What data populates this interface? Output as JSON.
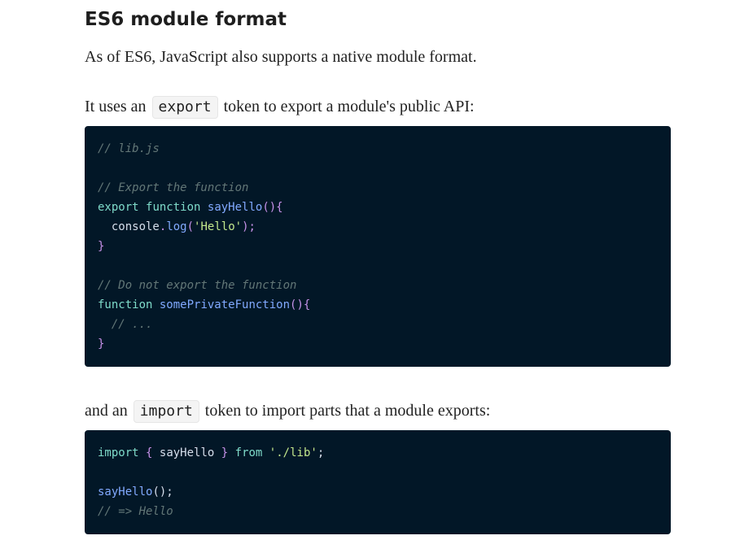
{
  "article": {
    "heading": "ES6 module format",
    "intro": "As of ES6, JavaScript also supports a native module format.",
    "export_text_before": "It uses an",
    "export_token": "export",
    "export_text_after": "token to export a module's public API:",
    "import_text_before": "and an",
    "import_token": "import",
    "import_text_after": "token to import parts that a module exports:"
  },
  "code_export": {
    "l1": "// lib.js",
    "l3": "// Export the function",
    "l4_kw1": "export",
    "l4_kw2": "function",
    "l4_fn": "sayHello",
    "l4_p": "(){",
    "l5_obj": "console",
    "l5_dot": ".",
    "l5_fn": "log",
    "l5_p1": "(",
    "l5_str": "'Hello'",
    "l5_p2": ");",
    "l6": "}",
    "l8": "// Do not export the function",
    "l9_kw": "function",
    "l9_fn": "somePrivateFunction",
    "l9_p": "(){",
    "l10": "// ...",
    "l11": "}"
  },
  "code_import": {
    "l1_kw": "import",
    "l1_b1": "{",
    "l1_name": "sayHello",
    "l1_b2": "}",
    "l1_from": "from",
    "l1_str": "'./lib'",
    "l1_semi": ";",
    "l3_fn": "sayHello",
    "l3_p": "();",
    "l4": "// => Hello"
  }
}
